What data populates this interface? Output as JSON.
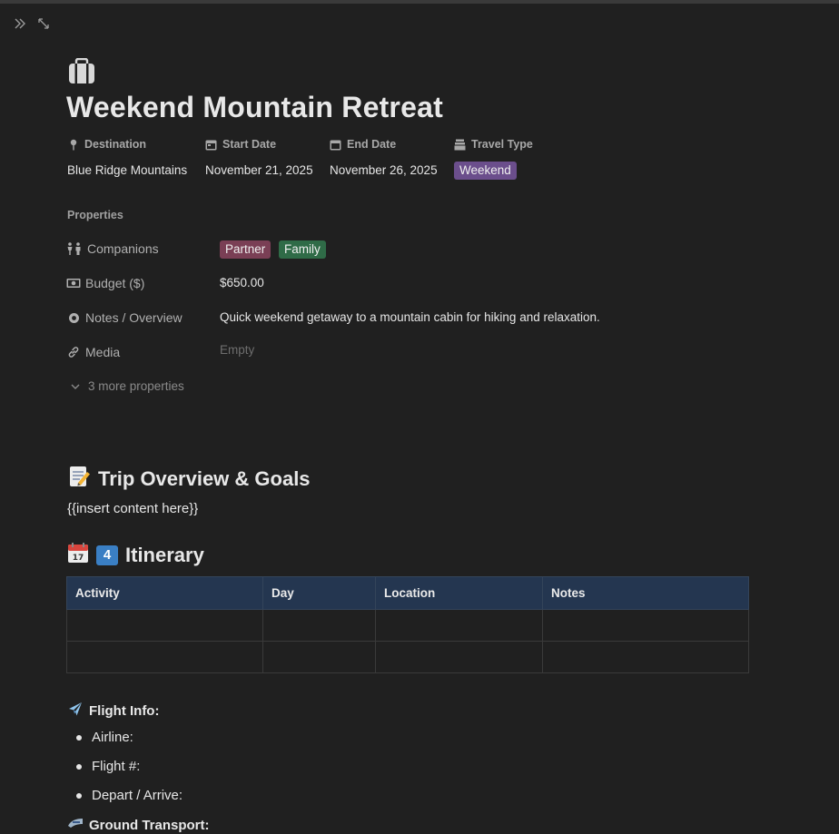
{
  "toolbar": {
    "sidebar_icon": "double-chevron-right-icon",
    "expand_icon": "expand-arrows-icon"
  },
  "page": {
    "icon": "suitcase-icon",
    "title": "Weekend Mountain Retreat"
  },
  "header_properties": [
    {
      "label": "Destination",
      "icon": "pin-icon",
      "value": "Blue Ridge Mountains"
    },
    {
      "label": "Start Date",
      "icon": "calendar-icon",
      "value": "November 21, 2025"
    },
    {
      "label": "End Date",
      "icon": "calendar-icon",
      "value": "November 26, 2025"
    },
    {
      "label": "Travel Type",
      "icon": "stack-icon",
      "value": "Weekend",
      "color": "#6b4e8c"
    }
  ],
  "properties": {
    "heading": "Properties",
    "companions": {
      "label": "Companions",
      "icon": "people-icon",
      "tags": [
        {
          "text": "Partner",
          "color": "#7a3f55"
        },
        {
          "text": "Family",
          "color": "#2f6b47"
        }
      ]
    },
    "budget": {
      "label": "Budget ($)",
      "icon": "cash-icon",
      "value": "$650.00"
    },
    "notes": {
      "label": "Notes / Overview",
      "icon": "circle-icon",
      "value": "Quick weekend getaway to a mountain cabin for hiking and relaxation."
    },
    "media": {
      "label": "Media",
      "icon": "link-icon",
      "value": "Empty"
    },
    "more": "3 more properties"
  },
  "sections": {
    "overview": {
      "title": "Trip Overview & Goals",
      "icon": "memo-icon",
      "content": "{{insert content here}}"
    },
    "itinerary": {
      "title": "Itinerary",
      "icons": [
        "calendar-emoji-icon",
        "keycap-4-icon"
      ],
      "keycap": "4",
      "columns": [
        "Activity",
        "Day",
        "Location",
        "Notes"
      ],
      "rows": [
        [
          "",
          "",
          "",
          ""
        ],
        [
          "",
          "",
          "",
          ""
        ]
      ]
    },
    "flight": {
      "title": "Flight Info:",
      "icon": "airplane-icon",
      "items": [
        "Airline:",
        "Flight #:",
        "Depart / Arrive:"
      ]
    },
    "ground": {
      "title": "Ground Transport:",
      "icon": "train-icon"
    }
  },
  "colors": {
    "background": "#202020",
    "table_header": "#243650"
  }
}
